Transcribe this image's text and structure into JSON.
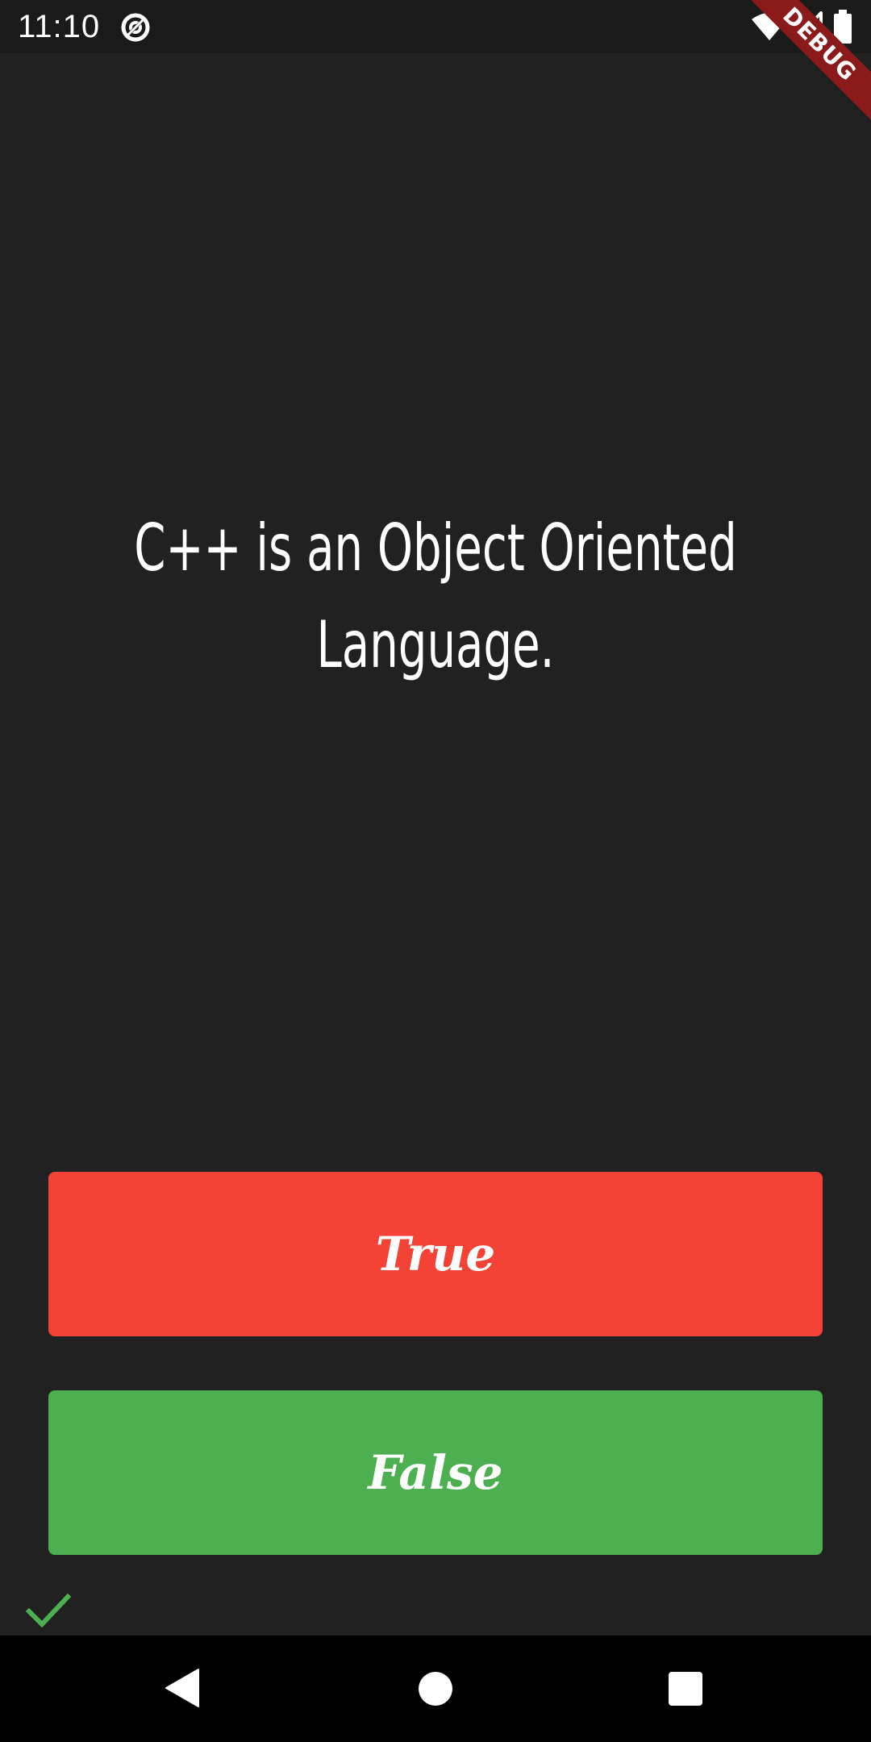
{
  "status_bar": {
    "time": "11:10",
    "icons": [
      "at-sign-icon",
      "wifi-icon",
      "signal-icon",
      "battery-icon"
    ]
  },
  "debug_banner": {
    "label": "DEBUG",
    "color": "#8b1a1a"
  },
  "question": {
    "text": "C++ is an Object Oriented Language."
  },
  "buttons": {
    "true_label": "True",
    "true_color": "#f44336",
    "false_label": "False",
    "false_color": "#4caf50"
  },
  "score_keeper": {
    "icons": [
      "check-icon"
    ],
    "check_color": "#4caf50"
  },
  "nav_bar": {
    "icons": [
      "back-icon",
      "home-icon",
      "recents-icon"
    ]
  }
}
